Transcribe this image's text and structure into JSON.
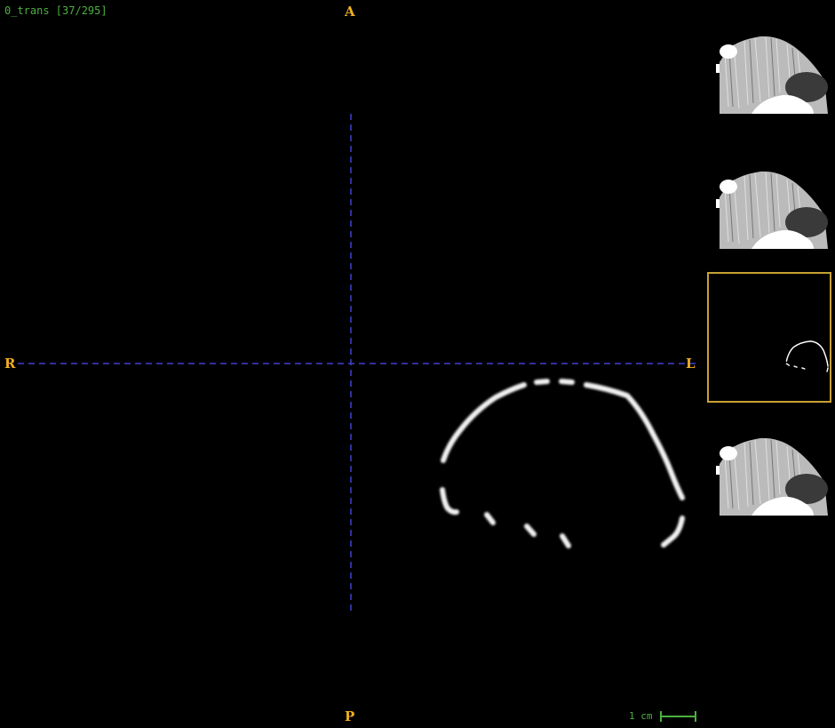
{
  "viewer": {
    "series_label": "0_trans [37/295]",
    "orientation": {
      "anterior": "A",
      "posterior": "P",
      "right": "R",
      "left": "L"
    },
    "scale_label": "1 cm",
    "colors": {
      "overlay_text": "#4caf3f",
      "orientation_marker": "#f0b020",
      "crosshair": "#4040d0",
      "active_thumbnail_border": "#c8a032"
    }
  },
  "thumbnails": [
    {
      "name": "slice-thumbnail-1",
      "active": false
    },
    {
      "name": "slice-thumbnail-2",
      "active": false
    },
    {
      "name": "slice-thumbnail-3",
      "active": true
    },
    {
      "name": "slice-thumbnail-4",
      "active": false
    }
  ]
}
